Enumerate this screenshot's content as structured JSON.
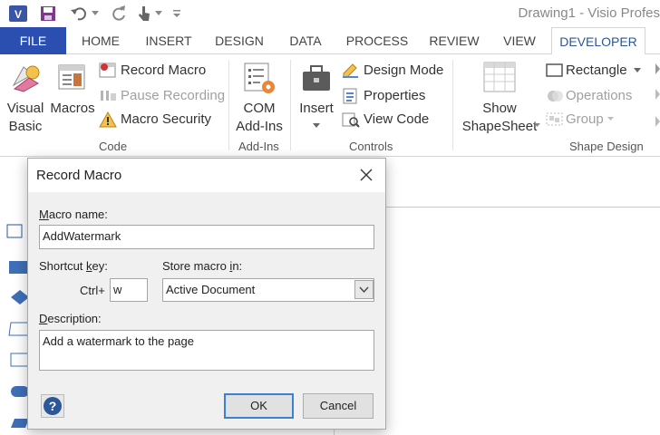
{
  "window": {
    "title": "Drawing1 - Visio Profes"
  },
  "tabs": [
    "FILE",
    "HOME",
    "INSERT",
    "DESIGN",
    "DATA",
    "PROCESS",
    "REVIEW",
    "VIEW",
    "DEVELOPER"
  ],
  "ribbon": {
    "code": {
      "visual_basic": [
        "Visual",
        "Basic"
      ],
      "macros": "Macros",
      "record_macro": "Record Macro",
      "pause_recording": "Pause Recording",
      "macro_security": "Macro Security",
      "label": "Code"
    },
    "addins": {
      "com": [
        "COM",
        "Add-Ins"
      ],
      "label": "Add-Ins"
    },
    "controls": {
      "insert": "Insert",
      "design_mode": "Design Mode",
      "properties": "Properties",
      "view_code": "View Code",
      "label": "Controls"
    },
    "shape_design": {
      "show_shapesheet": [
        "Show",
        "ShapeSheet"
      ],
      "rectangle": "Rectangle",
      "operations": "Operations",
      "group": "Group",
      "label": "Shape Design"
    }
  },
  "dialog": {
    "title": "Record Macro",
    "macro_name_label": {
      "u": "M",
      "rest": "acro name:"
    },
    "macro_name_value": "AddWatermark",
    "shortcut_label": {
      "pre": "Shortcut ",
      "u": "k",
      "rest": "ey:"
    },
    "ctrl_label": "Ctrl+",
    "shortcut_value": "w",
    "store_label": {
      "pre": "Store macro ",
      "u": "i",
      "rest": "n:"
    },
    "store_value": "Active Document",
    "description_label": {
      "u": "D",
      "rest": "escription:"
    },
    "description_value": "Add a watermark to the page",
    "ok": "OK",
    "cancel": "Cancel"
  },
  "colors": {
    "file_tab": "#2b4fb0",
    "accent": "#2b579a",
    "default_button_border": "#3c7fd4"
  }
}
